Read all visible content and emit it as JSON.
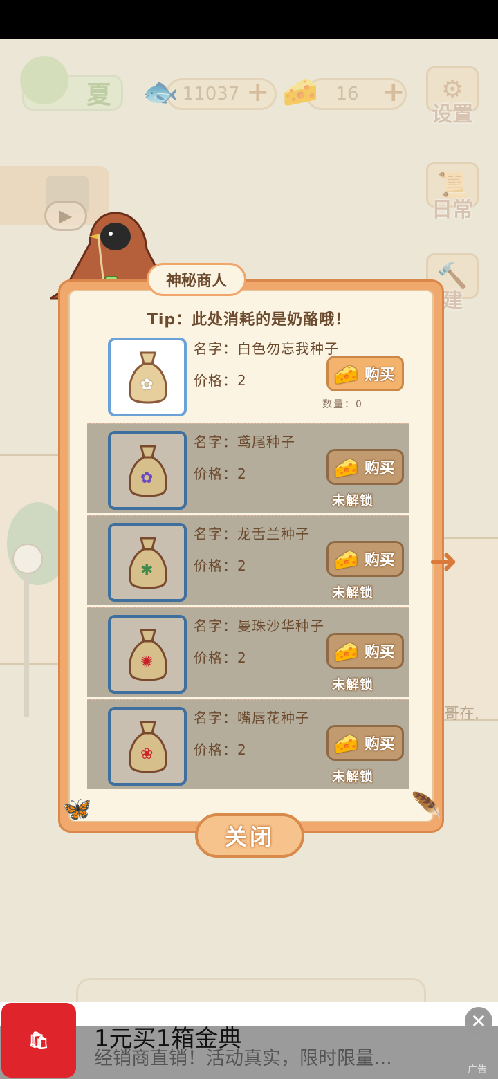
{
  "hud": {
    "season": "夏",
    "fish_count": "11037",
    "cheese_count": "16",
    "settings_label": "设置",
    "daily_label": "日常",
    "build_label": "建"
  },
  "dialog": {
    "title": "神秘商人",
    "tip": "Tip：此处消耗的是奶酪哦！",
    "close_label": "关闭",
    "buy_label": "购买",
    "locked_label": "未解锁",
    "items": [
      {
        "name": "名字：白色勿忘我种子",
        "price": "价格：2",
        "quantity": "数量：0",
        "flower_color": "#ffffff",
        "locked": false
      },
      {
        "name": "名字：鸢尾种子",
        "price": "价格：2",
        "flower_color": "#6b4bc2",
        "locked": true
      },
      {
        "name": "名字：龙舌兰种子",
        "price": "价格：2",
        "flower_color": "#3f8a4a",
        "locked": true
      },
      {
        "name": "名字：曼珠沙华种子",
        "price": "价格：2",
        "flower_color": "#c81e2a",
        "locked": true
      },
      {
        "name": "名字：嘴唇花种子",
        "price": "价格：2",
        "flower_color": "#d0242c",
        "locked": true
      }
    ]
  },
  "background_text": "哥在.",
  "ad": {
    "title": "1元买1箱金典",
    "description": "经销商直销！活动真实，限时限量...",
    "tag": "广告",
    "brand_color": "#e0242c"
  }
}
